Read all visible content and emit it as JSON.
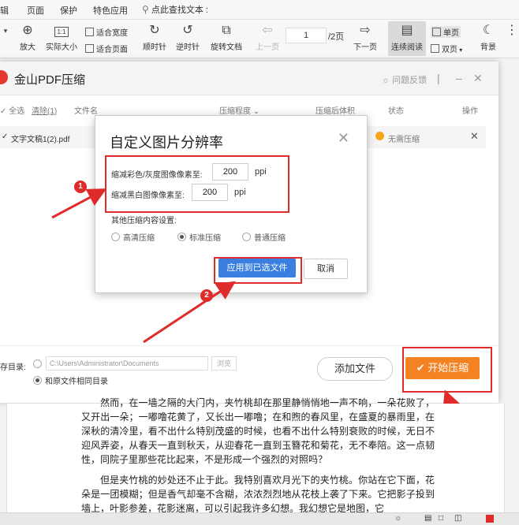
{
  "menubar": {
    "items": [
      "辑",
      "页面",
      "保护",
      "特色应用"
    ],
    "search_text": "点此查找文本"
  },
  "toolbar": {
    "zoom_in": "放大",
    "actual_size": "实际大小",
    "fit_width": "适合宽度",
    "fit_page": "适合页面",
    "rotate_cw": "顺时针",
    "rotate_ccw": "逆时针",
    "rotate_doc": "旋转文档",
    "prev_page": "上一页",
    "page_current": "1",
    "page_total": "/2页",
    "next_page": "下一页",
    "continuous": "连续阅读",
    "single_page": "单页",
    "double_page": "双页",
    "background": "背景",
    "actual_icon_text": "1:1"
  },
  "window": {
    "title": "金山PDF压缩",
    "feedback": "问题反馈",
    "select_all": "全选",
    "clear": "清除(1)",
    "col_filename": "文件名",
    "col_level": "压缩程度",
    "col_after": "压缩后体积",
    "col_status": "状态",
    "col_action": "操作",
    "file_name": "文字文稿1(2).pdf",
    "file_status": "无需压缩",
    "save_dir_label": "存目录:",
    "save_dir_path": "C:\\Users\\Administrator\\Documents",
    "browse": "浏览",
    "same_dir": "和原文件相同目录",
    "add_file": "添加文件",
    "start_compress": "开始压缩"
  },
  "dialog": {
    "title": "自定义图片分辨率",
    "color_label": "缩减彩色/灰度图像像素至:",
    "color_value": "200",
    "mono_label": "缩减黑白图像像素至:",
    "mono_value": "200",
    "unit": "ppi",
    "other_settings": "其他压缩内容设置:",
    "opt_hd": "高清压缩",
    "opt_std": "标准压缩",
    "opt_normal": "普通压缩",
    "apply_button": "应用到已选文件",
    "cancel_button": "取消"
  },
  "annotations": {
    "n1": "1",
    "n2": "2",
    "n3": "3"
  },
  "document": {
    "p1": "然而，在一墙之隔的大门内，夹竹桃却在那里静悄悄地一声不响，一朵花败了，又开出一朵；一嘟噜花黄了，又长出一嘟噜；在和煦的春风里，在盛夏的暴雨里，在深秋的清冷里，看不出什么特别茂盛的时候，也看不出什么特别衰败的时候，无日不迎风弄姿，从春天一直到秋天，从迎春花一直到玉簪花和菊花，无不奉陪。这一点韧性，同院子里那些花比起来，不是形成一个强烈的对照吗？",
    "p2": "但是夹竹桃的妙处还不止于此。我特别喜欢月光下的夹竹桃。你站在它下面，花朵是一团模糊；但是香气却毫不含糊，浓浓烈烈地从花枝上袭了下来。它把影子投到墙上，叶影参差，花影迷离，可以引起我许多幻想。我幻想它是地图，它"
  },
  "colors": {
    "accent_blue": "#3a7fe0",
    "accent_orange": "#f48222",
    "annotation_red": "#e02b2b"
  }
}
